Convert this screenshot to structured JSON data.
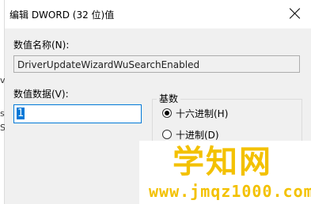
{
  "window": {
    "title": "编辑 DWORD (32 位)值"
  },
  "value_name": {
    "label": "数值名称(N):",
    "value": "DriverUpdateWizardWuSearchEnabled"
  },
  "value_data": {
    "label": "数值数据(V):",
    "selected": "1"
  },
  "base": {
    "title": "基数",
    "options": [
      {
        "label": "十六进制(H)",
        "checked": true
      },
      {
        "label": "十进制(D)",
        "checked": false
      }
    ]
  },
  "watermark": {
    "title": "学知网",
    "url": "www.jmqz1000.com"
  },
  "left_strip": {
    "chars": [
      "v",
      "s",
      "S"
    ]
  }
}
